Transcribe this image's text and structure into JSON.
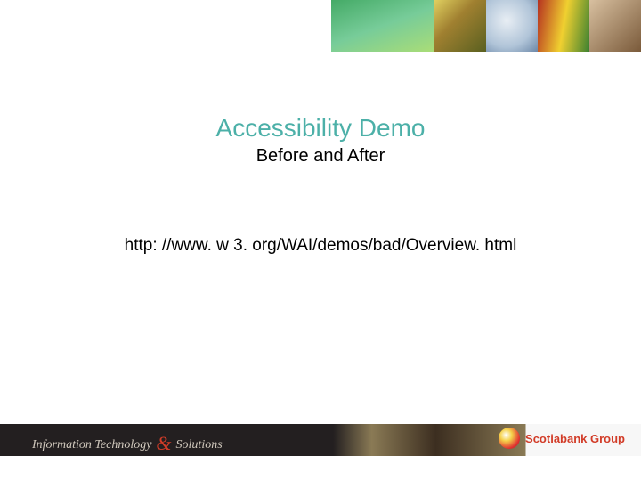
{
  "slide": {
    "title": "Accessibility Demo",
    "subtitle": "Before and After",
    "url": "http: //www. w 3. org/WAI/demos/bad/Overview. html"
  },
  "footer": {
    "left_part1": "Information Technology",
    "left_amp": "&",
    "left_part2": "Solutions",
    "brand": "Scotiabank Group"
  }
}
